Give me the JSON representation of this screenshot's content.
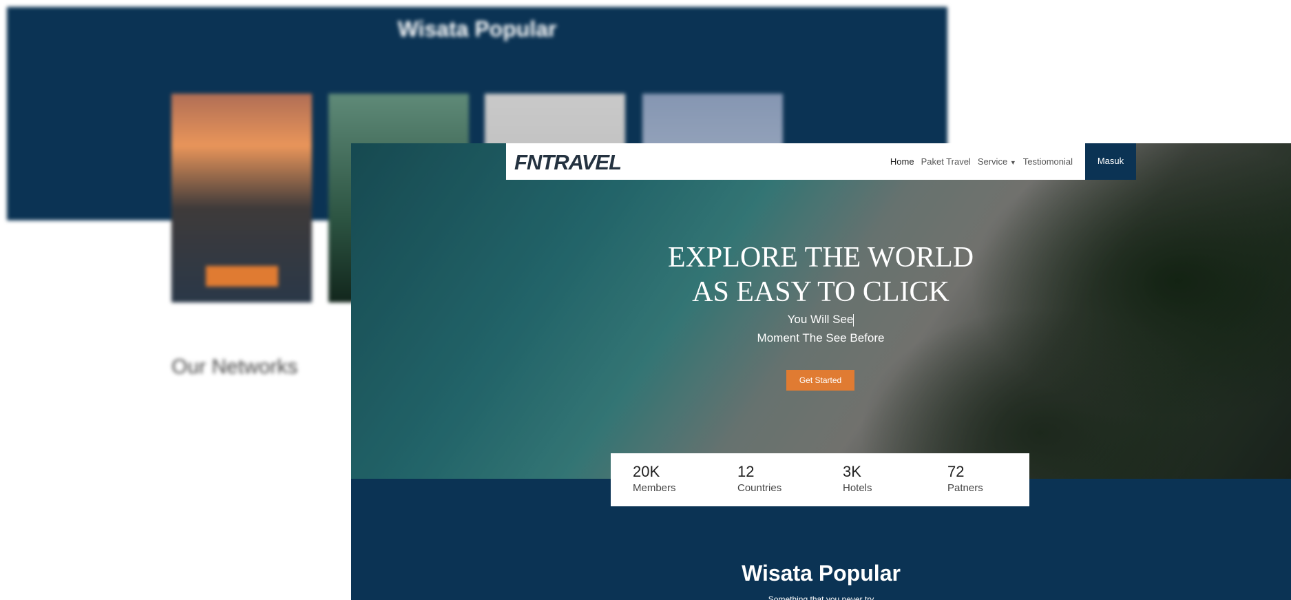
{
  "background_page": {
    "section_title": "Wisata Popular",
    "networks_title": "Our Networks"
  },
  "navbar": {
    "logo": "FNTRAVEL",
    "links": [
      "Home",
      "Paket Travel",
      "Service",
      "Testiomonial"
    ],
    "login_label": "Masuk"
  },
  "hero": {
    "title_line1": "EXPLORE THE WORLD",
    "title_line2": "AS EASY TO CLICK",
    "subtitle_line1": "You Will See",
    "subtitle_line2": "Moment The See Before",
    "cta_label": "Get Started"
  },
  "stats": [
    {
      "value": "20K",
      "label": "Members"
    },
    {
      "value": "12",
      "label": "Countries"
    },
    {
      "value": "3K",
      "label": "Hotels"
    },
    {
      "value": "72",
      "label": "Patners"
    }
  ],
  "popular": {
    "title": "Wisata Popular",
    "subtitle": "Something that you never try"
  },
  "colors": {
    "navy": "#0b3354",
    "accent": "#e07b32"
  }
}
